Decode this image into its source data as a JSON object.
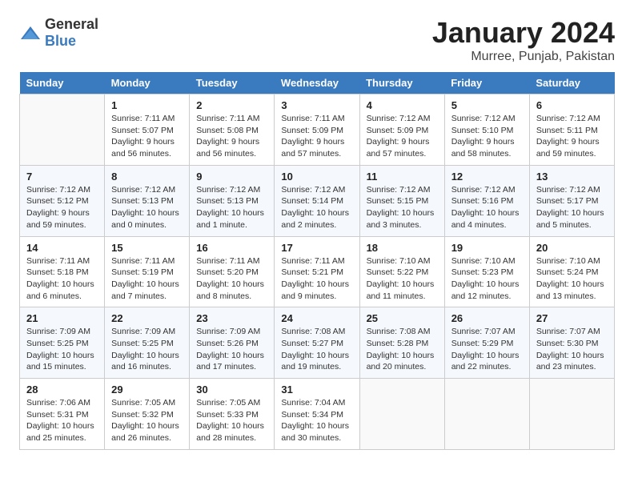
{
  "logo": {
    "text_general": "General",
    "text_blue": "Blue"
  },
  "header": {
    "month": "January 2024",
    "location": "Murree, Punjab, Pakistan"
  },
  "weekdays": [
    "Sunday",
    "Monday",
    "Tuesday",
    "Wednesday",
    "Thursday",
    "Friday",
    "Saturday"
  ],
  "weeks": [
    [
      {
        "day": "",
        "info": ""
      },
      {
        "day": "1",
        "info": "Sunrise: 7:11 AM\nSunset: 5:07 PM\nDaylight: 9 hours\nand 56 minutes."
      },
      {
        "day": "2",
        "info": "Sunrise: 7:11 AM\nSunset: 5:08 PM\nDaylight: 9 hours\nand 56 minutes."
      },
      {
        "day": "3",
        "info": "Sunrise: 7:11 AM\nSunset: 5:09 PM\nDaylight: 9 hours\nand 57 minutes."
      },
      {
        "day": "4",
        "info": "Sunrise: 7:12 AM\nSunset: 5:09 PM\nDaylight: 9 hours\nand 57 minutes."
      },
      {
        "day": "5",
        "info": "Sunrise: 7:12 AM\nSunset: 5:10 PM\nDaylight: 9 hours\nand 58 minutes."
      },
      {
        "day": "6",
        "info": "Sunrise: 7:12 AM\nSunset: 5:11 PM\nDaylight: 9 hours\nand 59 minutes."
      }
    ],
    [
      {
        "day": "7",
        "info": "Sunrise: 7:12 AM\nSunset: 5:12 PM\nDaylight: 9 hours\nand 59 minutes."
      },
      {
        "day": "8",
        "info": "Sunrise: 7:12 AM\nSunset: 5:13 PM\nDaylight: 10 hours\nand 0 minutes."
      },
      {
        "day": "9",
        "info": "Sunrise: 7:12 AM\nSunset: 5:13 PM\nDaylight: 10 hours\nand 1 minute."
      },
      {
        "day": "10",
        "info": "Sunrise: 7:12 AM\nSunset: 5:14 PM\nDaylight: 10 hours\nand 2 minutes."
      },
      {
        "day": "11",
        "info": "Sunrise: 7:12 AM\nSunset: 5:15 PM\nDaylight: 10 hours\nand 3 minutes."
      },
      {
        "day": "12",
        "info": "Sunrise: 7:12 AM\nSunset: 5:16 PM\nDaylight: 10 hours\nand 4 minutes."
      },
      {
        "day": "13",
        "info": "Sunrise: 7:12 AM\nSunset: 5:17 PM\nDaylight: 10 hours\nand 5 minutes."
      }
    ],
    [
      {
        "day": "14",
        "info": "Sunrise: 7:11 AM\nSunset: 5:18 PM\nDaylight: 10 hours\nand 6 minutes."
      },
      {
        "day": "15",
        "info": "Sunrise: 7:11 AM\nSunset: 5:19 PM\nDaylight: 10 hours\nand 7 minutes."
      },
      {
        "day": "16",
        "info": "Sunrise: 7:11 AM\nSunset: 5:20 PM\nDaylight: 10 hours\nand 8 minutes."
      },
      {
        "day": "17",
        "info": "Sunrise: 7:11 AM\nSunset: 5:21 PM\nDaylight: 10 hours\nand 9 minutes."
      },
      {
        "day": "18",
        "info": "Sunrise: 7:10 AM\nSunset: 5:22 PM\nDaylight: 10 hours\nand 11 minutes."
      },
      {
        "day": "19",
        "info": "Sunrise: 7:10 AM\nSunset: 5:23 PM\nDaylight: 10 hours\nand 12 minutes."
      },
      {
        "day": "20",
        "info": "Sunrise: 7:10 AM\nSunset: 5:24 PM\nDaylight: 10 hours\nand 13 minutes."
      }
    ],
    [
      {
        "day": "21",
        "info": "Sunrise: 7:09 AM\nSunset: 5:25 PM\nDaylight: 10 hours\nand 15 minutes."
      },
      {
        "day": "22",
        "info": "Sunrise: 7:09 AM\nSunset: 5:25 PM\nDaylight: 10 hours\nand 16 minutes."
      },
      {
        "day": "23",
        "info": "Sunrise: 7:09 AM\nSunset: 5:26 PM\nDaylight: 10 hours\nand 17 minutes."
      },
      {
        "day": "24",
        "info": "Sunrise: 7:08 AM\nSunset: 5:27 PM\nDaylight: 10 hours\nand 19 minutes."
      },
      {
        "day": "25",
        "info": "Sunrise: 7:08 AM\nSunset: 5:28 PM\nDaylight: 10 hours\nand 20 minutes."
      },
      {
        "day": "26",
        "info": "Sunrise: 7:07 AM\nSunset: 5:29 PM\nDaylight: 10 hours\nand 22 minutes."
      },
      {
        "day": "27",
        "info": "Sunrise: 7:07 AM\nSunset: 5:30 PM\nDaylight: 10 hours\nand 23 minutes."
      }
    ],
    [
      {
        "day": "28",
        "info": "Sunrise: 7:06 AM\nSunset: 5:31 PM\nDaylight: 10 hours\nand 25 minutes."
      },
      {
        "day": "29",
        "info": "Sunrise: 7:05 AM\nSunset: 5:32 PM\nDaylight: 10 hours\nand 26 minutes."
      },
      {
        "day": "30",
        "info": "Sunrise: 7:05 AM\nSunset: 5:33 PM\nDaylight: 10 hours\nand 28 minutes."
      },
      {
        "day": "31",
        "info": "Sunrise: 7:04 AM\nSunset: 5:34 PM\nDaylight: 10 hours\nand 30 minutes."
      },
      {
        "day": "",
        "info": ""
      },
      {
        "day": "",
        "info": ""
      },
      {
        "day": "",
        "info": ""
      }
    ]
  ]
}
